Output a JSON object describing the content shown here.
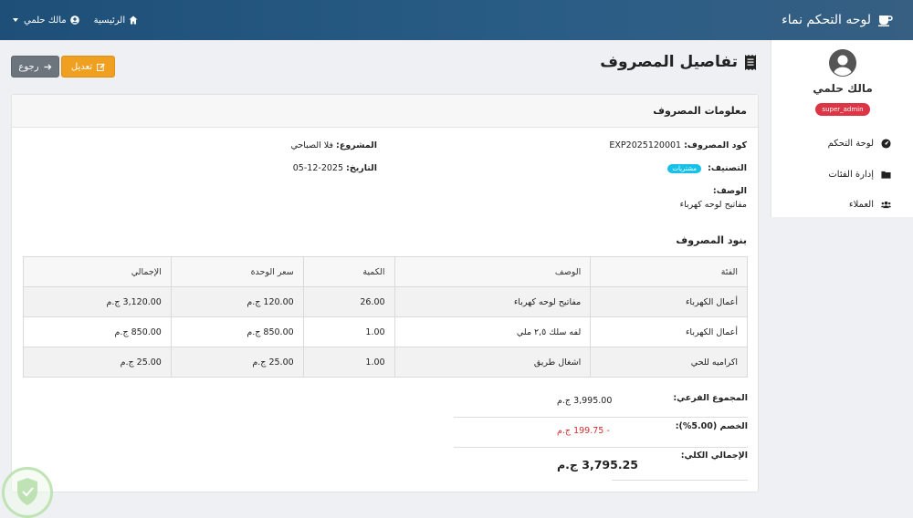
{
  "navbar": {
    "brand": "لوحه التحكم نماء",
    "home_label": "الرئيسية",
    "user_label": "مالك حلمي"
  },
  "sidebar": {
    "user_name": "مالك حلمي",
    "role": "super_admin",
    "items": [
      {
        "label": "لوحة التحكم",
        "icon": "dashboard-icon"
      },
      {
        "label": "إدارة الفئات",
        "icon": "folder-icon"
      },
      {
        "label": "العملاء",
        "icon": "users-icon"
      }
    ]
  },
  "page": {
    "title": "تفاصيل المصروف",
    "edit_label": "تعديل",
    "back_label": "رجوع"
  },
  "info": {
    "header": "معلومات المصروف",
    "code_label": "كود المصروف:",
    "code_value": "EXP2025120001",
    "project_label": "المشروع:",
    "project_value": "فلا الصباحي",
    "category_label": "التصنيف:",
    "category_value": "مشتريات",
    "date_label": "التاريخ:",
    "date_value": "2025-12-05",
    "desc_label": "الوصف:",
    "desc_value": "مفاتيح لوحه كهرباء"
  },
  "items": {
    "title": "بنود المصروف",
    "columns": [
      "الفئة",
      "الوصف",
      "الكمية",
      "سعر الوحدة",
      "الإجمالي"
    ],
    "rows": [
      {
        "category": "أعمال الكهرباء",
        "description": "مفاتيح لوحه كهرباء",
        "qty": "26.00",
        "unit_price": "120.00 ج.م",
        "total": "3,120.00 ج.م"
      },
      {
        "category": "أعمال الكهرباء",
        "description": "لفه سلك ٢,٥ ملي",
        "qty": "1.00",
        "unit_price": "850.00 ج.م",
        "total": "850.00 ج.م"
      },
      {
        "category": "اكراميه للحي",
        "description": "اشغال طريق",
        "qty": "1.00",
        "unit_price": "25.00 ج.م",
        "total": "25.00 ج.م"
      }
    ]
  },
  "summary": {
    "subtotal_label": "المجموع الفرعي:",
    "subtotal_value": "3,995.00 ج.م",
    "discount_label": "الخصم (5.00%):",
    "discount_value": "- 199.75 ج.م",
    "total_label": "الإجمالي الكلي:",
    "total_value": "3,795.25 ج.م"
  },
  "colors": {
    "navbar": "#2a5d86",
    "edit_button": "#f0a020",
    "back_button": "#6c757d",
    "role_badge": "#dc3545",
    "category_pill": "#17c0e8",
    "discount_text": "#d32f2f"
  }
}
